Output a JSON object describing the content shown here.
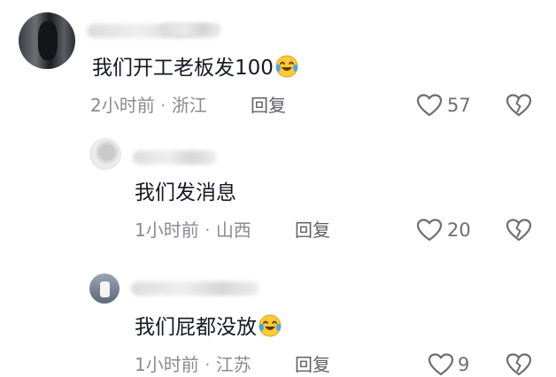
{
  "comments": [
    {
      "text": "我们开工老板发100",
      "time": "2小时前",
      "location": "浙江",
      "reply_label": "回复",
      "likes": "57",
      "emoji": "laughing-crying-emoji"
    },
    {
      "text": "我们发消息",
      "time": "1小时前",
      "location": "山西",
      "reply_label": "回复",
      "likes": "20"
    },
    {
      "text": "我们屁都没放",
      "time": "1小时前",
      "location": "江苏",
      "reply_label": "回复",
      "likes": "9",
      "emoji": "laughing-crying-emoji"
    }
  ],
  "separator": "·",
  "colors": {
    "text": "#161823",
    "meta": "#8a8b91",
    "icon": "#6d6e73"
  }
}
